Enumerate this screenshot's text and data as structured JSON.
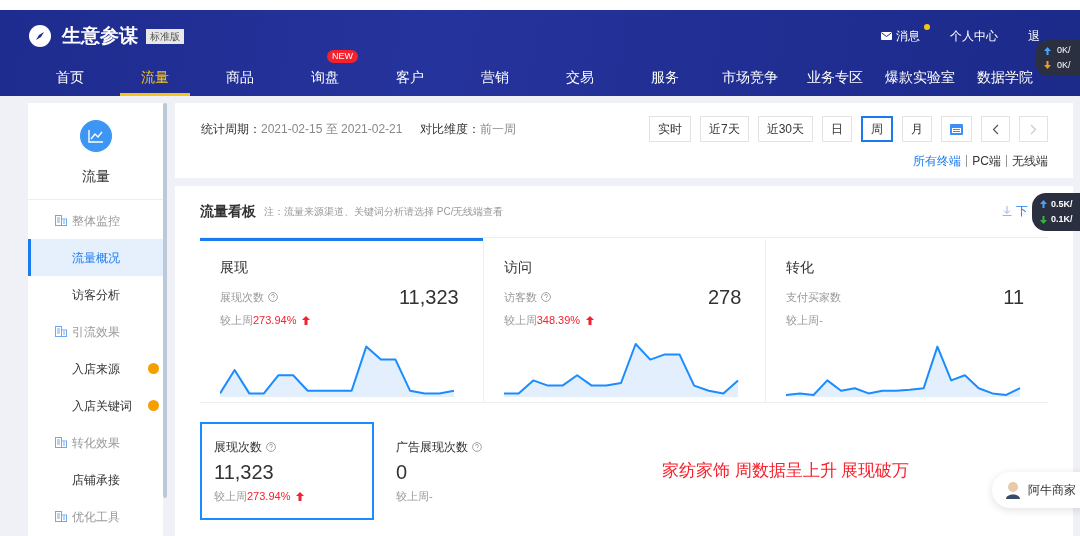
{
  "header": {
    "brand": "生意参谋",
    "edition": "标准版",
    "links": [
      {
        "label": "消息",
        "dot": true
      },
      {
        "label": "个人中心",
        "dot": false
      }
    ],
    "exit": "退",
    "nav": [
      {
        "label": "首页",
        "selected": false
      },
      {
        "label": "流量",
        "selected": true
      },
      {
        "label": "商品",
        "selected": false
      },
      {
        "label": "询盘",
        "selected": false,
        "badge": "NEW"
      },
      {
        "label": "客户",
        "selected": false
      },
      {
        "label": "营销",
        "selected": false
      },
      {
        "label": "交易",
        "selected": false
      },
      {
        "label": "服务",
        "selected": false
      },
      {
        "label": "市场竞争",
        "selected": false
      },
      {
        "label": "业务专区",
        "selected": false
      },
      {
        "label": "爆款实验室",
        "selected": false
      },
      {
        "label": "数据学院",
        "selected": false
      }
    ]
  },
  "speed_top": [
    "0K/",
    "0K/"
  ],
  "speed_mid": [
    "0.5K/",
    "0.1K/"
  ],
  "sidebar": {
    "title": "流量",
    "items": [
      {
        "kind": "group",
        "label": "整体监控"
      },
      {
        "kind": "link",
        "label": "流量概况",
        "selected": true,
        "dot": false
      },
      {
        "kind": "link",
        "label": "访客分析",
        "selected": false,
        "dot": false
      },
      {
        "kind": "group",
        "label": "引流效果"
      },
      {
        "kind": "link",
        "label": "入店来源",
        "selected": false,
        "dot": true
      },
      {
        "kind": "link",
        "label": "入店关键词",
        "selected": false,
        "dot": true
      },
      {
        "kind": "group",
        "label": "转化效果"
      },
      {
        "kind": "link",
        "label": "店铺承接",
        "selected": false,
        "dot": false
      },
      {
        "kind": "group",
        "label": "优化工具"
      }
    ]
  },
  "filter": {
    "period_label": "统计周期：",
    "period": "2021-02-15 至 2021-02-21",
    "compare_label": "对比维度：",
    "compare": "前一周",
    "buttons": [
      {
        "kind": "text",
        "label": "实时",
        "selected": false,
        "disabled": false
      },
      {
        "kind": "text",
        "label": "近7天",
        "selected": false,
        "disabled": false
      },
      {
        "kind": "text",
        "label": "近30天",
        "selected": false,
        "disabled": false
      },
      {
        "kind": "text",
        "label": "日",
        "selected": false,
        "disabled": false
      },
      {
        "kind": "text",
        "label": "周",
        "selected": true,
        "disabled": false
      },
      {
        "kind": "text",
        "label": "月",
        "selected": false,
        "disabled": false
      },
      {
        "kind": "calendar",
        "selected": false,
        "disabled": false
      },
      {
        "kind": "prev",
        "selected": false,
        "disabled": false
      },
      {
        "kind": "next",
        "selected": false,
        "disabled": true
      }
    ],
    "terminals": [
      {
        "label": "所有终端",
        "selected": true
      },
      {
        "label": "PC端",
        "selected": false
      },
      {
        "label": "无线端",
        "selected": false
      }
    ]
  },
  "board": {
    "title": "流量看板",
    "note": "注：流量来源渠道、关键词分析请选择 PC/无线端查看",
    "download": "下",
    "cards": [
      {
        "title": "展现",
        "metric": "展现次数",
        "help": true,
        "value": "11,323",
        "compare": "较上周",
        "change": "273.94%",
        "rising": true,
        "selected": true
      },
      {
        "title": "访问",
        "metric": "访客数",
        "help": true,
        "value": "278",
        "compare": "较上周",
        "change": "348.39%",
        "rising": true,
        "selected": false
      },
      {
        "title": "转化",
        "metric": "支付买家数",
        "help": false,
        "value": "11",
        "compare": "较上周",
        "change": "-",
        "rising": false,
        "selected": false
      }
    ],
    "metrics": [
      {
        "label": "展现次数",
        "value": "11,323",
        "compare": "较上周",
        "change": "273.94%",
        "rising": true,
        "selected": true
      },
      {
        "label": "广告展现次数",
        "value": "0",
        "compare": "较上周",
        "change": "-",
        "rising": false,
        "selected": false
      }
    ]
  },
  "annotation": "家纺家饰 周数据呈上升 展现破万",
  "assistant": "阿牛商家"
}
